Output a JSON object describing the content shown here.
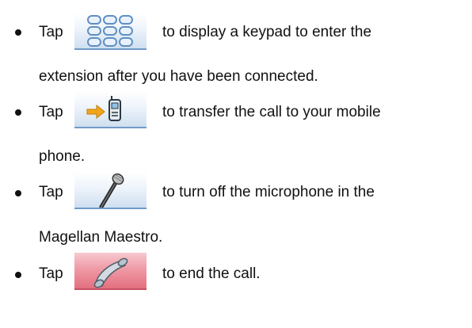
{
  "bullets": [
    {
      "tap": "Tap",
      "text_line1": "to display a keypad to enter the",
      "text_line2": "extension after you have been connected.",
      "icon": "keypad-icon"
    },
    {
      "tap": "Tap",
      "text_line1": "to transfer the call to your mobile",
      "text_line2": "phone.",
      "icon": "transfer-to-mobile-icon"
    },
    {
      "tap": "Tap",
      "text_line1": "to turn off the microphone in the",
      "text_line2": "Magellan Maestro.",
      "icon": "microphone-icon"
    },
    {
      "tap": "Tap",
      "text_line1": "to end the call.",
      "icon": "end-call-icon"
    }
  ],
  "colors": {
    "text": "#111111",
    "button_blue_top": "#ffffff",
    "button_blue_bottom": "#cfdff0",
    "button_blue_border": "#6f9cc8",
    "button_red_top": "#f7c9cf",
    "button_red_bottom": "#e4707f",
    "button_red_border": "#c65062",
    "arrow_orange": "#f2a51a"
  }
}
